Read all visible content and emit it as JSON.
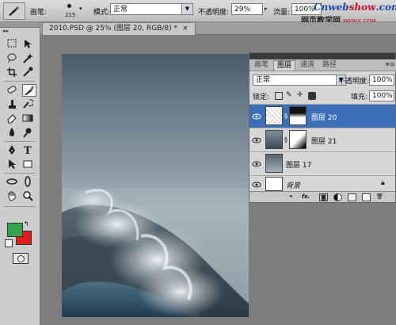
{
  "options_bar": {
    "brush_label": "画笔:",
    "brush_size": "215",
    "mode_label": "模式:",
    "mode_value": "正常",
    "opacity_label": "不透明度:",
    "opacity_value": "29%",
    "flow_label": "流量:",
    "flow_value": "100%"
  },
  "watermark": {
    "brand_a": "Cnweb",
    "brand_b": "show",
    "brand_c": ".com",
    "subtitle": "网页教学网",
    "url_small": "WEBJX.COM"
  },
  "document": {
    "tab_title": "2010.PSD @ 25% (图层 20, RGB/8) *",
    "close_glyph": "×"
  },
  "layers_panel": {
    "tabs": [
      "画笔",
      "图层",
      "通道",
      "路径"
    ],
    "active_tab": "图层",
    "blend_mode": "正常",
    "opacity_label": "不透明度:",
    "opacity_value": "100%",
    "lock_label": "锁定:",
    "fill_label": "填充:",
    "fill_value": "100%",
    "layers": [
      {
        "name": "图层 20",
        "selected": true,
        "has_mask": true
      },
      {
        "name": "图层 21",
        "selected": false,
        "has_mask": true
      },
      {
        "name": "图层 17",
        "selected": false,
        "has_mask": false
      },
      {
        "name": "背景",
        "selected": false,
        "has_mask": false,
        "locked": true
      }
    ],
    "footer_icons": [
      "link-icon",
      "fx-icon",
      "add-mask-icon",
      "adjustment-icon",
      "group-icon",
      "new-layer-icon",
      "trash-icon"
    ]
  },
  "colors": {
    "foreground": "#2fa64c",
    "background": "#e41b1b",
    "selection": "#3c6fb8"
  }
}
